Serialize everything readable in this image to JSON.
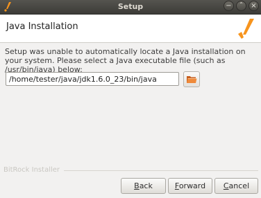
{
  "window": {
    "title": "Setup",
    "controls": [
      "minimize",
      "maximize",
      "close"
    ]
  },
  "header": {
    "title": "Java Installation",
    "logo_icon": "bitrock-checkmark-logo",
    "logo_color": "#f7941d"
  },
  "body": {
    "message": "Setup was unable to automatically locate a Java installation on your system. Please select a Java executable file (such as /usr/bin/java) below:",
    "path_value": "/home/tester/java/jdk1.6.0_23/bin/java",
    "browse_icon": "folder-open-icon"
  },
  "footer": {
    "installer_label": "BitRock Installer",
    "buttons": {
      "back": {
        "mnemonic": "B",
        "rest": "ack"
      },
      "forward": {
        "mnemonic": "F",
        "rest": "orward"
      },
      "cancel": {
        "mnemonic": "C",
        "rest": "ancel"
      }
    }
  }
}
